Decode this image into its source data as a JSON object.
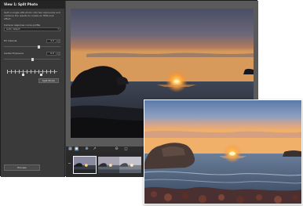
{
  "panel": {
    "title": "View 1: Split Photo",
    "description": "Split a single LDR photo into two exposures and combine the results to create an HDR-look effect.",
    "profile_label": "Camera response curve profile",
    "profile_value": "Auto detect",
    "ev_interval_label": "EV Interval",
    "ev_interval_value": "2.0",
    "center_exposure_label": "Center Exposure",
    "center_exposure_value": "0.0",
    "split_button": "Split Photo",
    "process_button": "Process"
  },
  "toolbar": {
    "icons": [
      "grid-view-icon",
      "single-view-icon",
      "zoom-in-icon",
      "share-icon",
      "zoom-out-icon",
      "fit-icon"
    ]
  },
  "colors": {
    "panel_bg": "#3a3a3a",
    "header_bg": "#242424",
    "preview_bg": "#5a5a5a",
    "filmstrip_bg": "#2a2a2a",
    "accent": "#3a5a7a"
  }
}
